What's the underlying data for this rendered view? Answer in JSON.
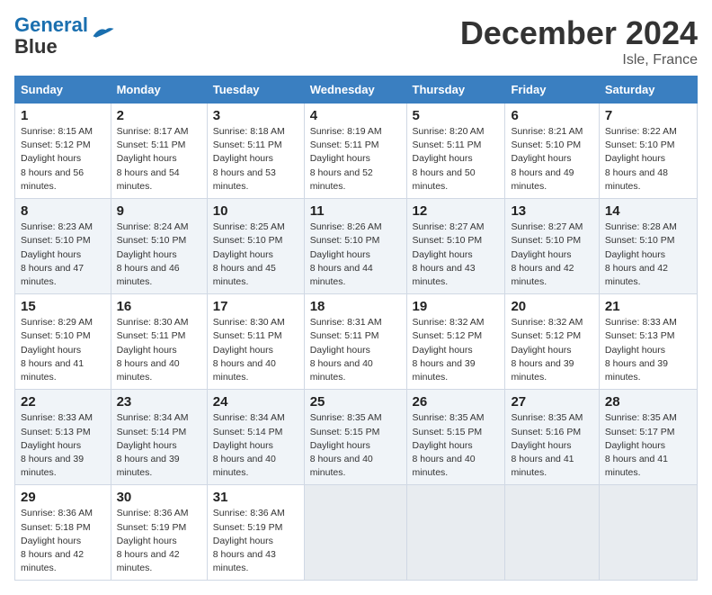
{
  "logo": {
    "line1": "General",
    "line2": "Blue"
  },
  "title": "December 2024",
  "location": "Isle, France",
  "days_header": [
    "Sunday",
    "Monday",
    "Tuesday",
    "Wednesday",
    "Thursday",
    "Friday",
    "Saturday"
  ],
  "weeks": [
    [
      {
        "day": "1",
        "sunrise": "8:15 AM",
        "sunset": "5:12 PM",
        "daylight": "8 hours and 56 minutes."
      },
      {
        "day": "2",
        "sunrise": "8:17 AM",
        "sunset": "5:11 PM",
        "daylight": "8 hours and 54 minutes."
      },
      {
        "day": "3",
        "sunrise": "8:18 AM",
        "sunset": "5:11 PM",
        "daylight": "8 hours and 53 minutes."
      },
      {
        "day": "4",
        "sunrise": "8:19 AM",
        "sunset": "5:11 PM",
        "daylight": "8 hours and 52 minutes."
      },
      {
        "day": "5",
        "sunrise": "8:20 AM",
        "sunset": "5:11 PM",
        "daylight": "8 hours and 50 minutes."
      },
      {
        "day": "6",
        "sunrise": "8:21 AM",
        "sunset": "5:10 PM",
        "daylight": "8 hours and 49 minutes."
      },
      {
        "day": "7",
        "sunrise": "8:22 AM",
        "sunset": "5:10 PM",
        "daylight": "8 hours and 48 minutes."
      }
    ],
    [
      {
        "day": "8",
        "sunrise": "8:23 AM",
        "sunset": "5:10 PM",
        "daylight": "8 hours and 47 minutes."
      },
      {
        "day": "9",
        "sunrise": "8:24 AM",
        "sunset": "5:10 PM",
        "daylight": "8 hours and 46 minutes."
      },
      {
        "day": "10",
        "sunrise": "8:25 AM",
        "sunset": "5:10 PM",
        "daylight": "8 hours and 45 minutes."
      },
      {
        "day": "11",
        "sunrise": "8:26 AM",
        "sunset": "5:10 PM",
        "daylight": "8 hours and 44 minutes."
      },
      {
        "day": "12",
        "sunrise": "8:27 AM",
        "sunset": "5:10 PM",
        "daylight": "8 hours and 43 minutes."
      },
      {
        "day": "13",
        "sunrise": "8:27 AM",
        "sunset": "5:10 PM",
        "daylight": "8 hours and 42 minutes."
      },
      {
        "day": "14",
        "sunrise": "8:28 AM",
        "sunset": "5:10 PM",
        "daylight": "8 hours and 42 minutes."
      }
    ],
    [
      {
        "day": "15",
        "sunrise": "8:29 AM",
        "sunset": "5:10 PM",
        "daylight": "8 hours and 41 minutes."
      },
      {
        "day": "16",
        "sunrise": "8:30 AM",
        "sunset": "5:11 PM",
        "daylight": "8 hours and 40 minutes."
      },
      {
        "day": "17",
        "sunrise": "8:30 AM",
        "sunset": "5:11 PM",
        "daylight": "8 hours and 40 minutes."
      },
      {
        "day": "18",
        "sunrise": "8:31 AM",
        "sunset": "5:11 PM",
        "daylight": "8 hours and 40 minutes."
      },
      {
        "day": "19",
        "sunrise": "8:32 AM",
        "sunset": "5:12 PM",
        "daylight": "8 hours and 39 minutes."
      },
      {
        "day": "20",
        "sunrise": "8:32 AM",
        "sunset": "5:12 PM",
        "daylight": "8 hours and 39 minutes."
      },
      {
        "day": "21",
        "sunrise": "8:33 AM",
        "sunset": "5:13 PM",
        "daylight": "8 hours and 39 minutes."
      }
    ],
    [
      {
        "day": "22",
        "sunrise": "8:33 AM",
        "sunset": "5:13 PM",
        "daylight": "8 hours and 39 minutes."
      },
      {
        "day": "23",
        "sunrise": "8:34 AM",
        "sunset": "5:14 PM",
        "daylight": "8 hours and 39 minutes."
      },
      {
        "day": "24",
        "sunrise": "8:34 AM",
        "sunset": "5:14 PM",
        "daylight": "8 hours and 40 minutes."
      },
      {
        "day": "25",
        "sunrise": "8:35 AM",
        "sunset": "5:15 PM",
        "daylight": "8 hours and 40 minutes."
      },
      {
        "day": "26",
        "sunrise": "8:35 AM",
        "sunset": "5:15 PM",
        "daylight": "8 hours and 40 minutes."
      },
      {
        "day": "27",
        "sunrise": "8:35 AM",
        "sunset": "5:16 PM",
        "daylight": "8 hours and 41 minutes."
      },
      {
        "day": "28",
        "sunrise": "8:35 AM",
        "sunset": "5:17 PM",
        "daylight": "8 hours and 41 minutes."
      }
    ],
    [
      {
        "day": "29",
        "sunrise": "8:36 AM",
        "sunset": "5:18 PM",
        "daylight": "8 hours and 42 minutes."
      },
      {
        "day": "30",
        "sunrise": "8:36 AM",
        "sunset": "5:19 PM",
        "daylight": "8 hours and 42 minutes."
      },
      {
        "day": "31",
        "sunrise": "8:36 AM",
        "sunset": "5:19 PM",
        "daylight": "8 hours and 43 minutes."
      },
      null,
      null,
      null,
      null
    ]
  ],
  "labels": {
    "sunrise": "Sunrise:",
    "sunset": "Sunset:",
    "daylight": "Daylight hours"
  }
}
